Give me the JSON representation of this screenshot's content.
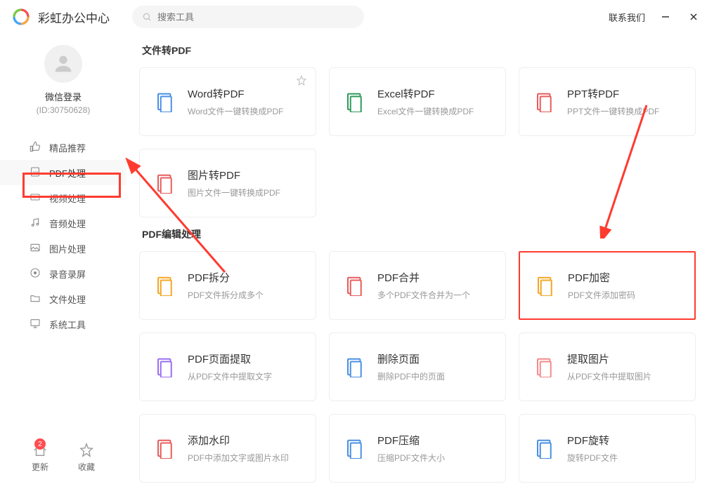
{
  "header": {
    "app_title": "彩虹办公中心",
    "search_placeholder": "搜索工具",
    "contact": "联系我们"
  },
  "sidebar": {
    "login_label": "微信登录",
    "login_id": "(ID:30750628)",
    "nav": [
      {
        "label": "精品推荐",
        "icon": "thumbs-up"
      },
      {
        "label": "PDF处理",
        "icon": "pdf"
      },
      {
        "label": "视频处理",
        "icon": "video"
      },
      {
        "label": "音频处理",
        "icon": "audio"
      },
      {
        "label": "图片处理",
        "icon": "image"
      },
      {
        "label": "录音录屏",
        "icon": "recorder"
      },
      {
        "label": "文件处理",
        "icon": "folder"
      },
      {
        "label": "系统工具",
        "icon": "system"
      }
    ],
    "active_index": 1,
    "bottom": {
      "update_label": "更新",
      "update_badge": "2",
      "favorite_label": "收藏"
    }
  },
  "main": {
    "sections": [
      {
        "title": "文件转PDF",
        "cards": [
          {
            "title": "Word转PDF",
            "desc": "Word文件一键转换成PDF",
            "icon_color": "#4a90e2",
            "star": true
          },
          {
            "title": "Excel转PDF",
            "desc": "Excel文件一键转换成PDF",
            "icon_color": "#2e9b5a"
          },
          {
            "title": "PPT转PDF",
            "desc": "PPT文件一键转换成PDF",
            "icon_color": "#e85c5c"
          },
          {
            "title": "图片转PDF",
            "desc": "图片文件一键转换成PDF",
            "icon_color": "#e85c5c"
          }
        ]
      },
      {
        "title": "PDF编辑处理",
        "cards": [
          {
            "title": "PDF拆分",
            "desc": "PDF文件拆分成多个",
            "icon_color": "#f5a623"
          },
          {
            "title": "PDF合并",
            "desc": "多个PDF文件合并为一个",
            "icon_color": "#e85c5c"
          },
          {
            "title": "PDF加密",
            "desc": "PDF文件添加密码",
            "icon_color": "#f5a623",
            "highlight": true
          },
          {
            "title": "PDF页面提取",
            "desc": "从PDF文件中提取文字",
            "icon_color": "#9b6ef3"
          },
          {
            "title": "删除页面",
            "desc": "删除PDF中的页面",
            "icon_color": "#4a90e2"
          },
          {
            "title": "提取图片",
            "desc": "从PDF文件中提取图片",
            "icon_color": "#f58a8a"
          },
          {
            "title": "添加水印",
            "desc": "PDF中添加文字或图片水印",
            "icon_color": "#e85c5c"
          },
          {
            "title": "PDF压缩",
            "desc": "压缩PDF文件大小",
            "icon_color": "#4a90e2"
          },
          {
            "title": "PDF旋转",
            "desc": "旋转PDF文件",
            "icon_color": "#4a90e2"
          }
        ]
      }
    ]
  }
}
